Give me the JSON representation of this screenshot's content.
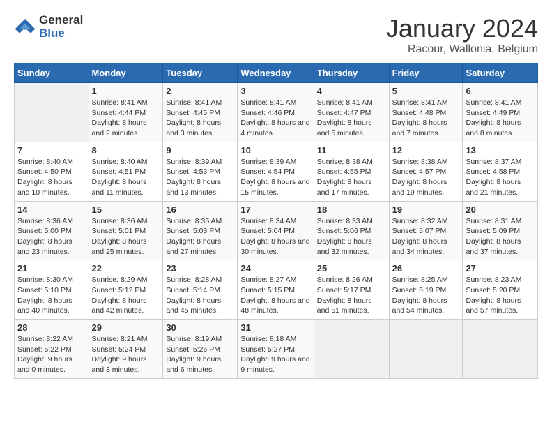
{
  "logo": {
    "general": "General",
    "blue": "Blue"
  },
  "title": "January 2024",
  "subtitle": "Racour, Wallonia, Belgium",
  "days_header": [
    "Sunday",
    "Monday",
    "Tuesday",
    "Wednesday",
    "Thursday",
    "Friday",
    "Saturday"
  ],
  "weeks": [
    [
      {
        "day": "",
        "sunrise": "",
        "sunset": "",
        "daylight": ""
      },
      {
        "day": "1",
        "sunrise": "Sunrise: 8:41 AM",
        "sunset": "Sunset: 4:44 PM",
        "daylight": "Daylight: 8 hours and 2 minutes."
      },
      {
        "day": "2",
        "sunrise": "Sunrise: 8:41 AM",
        "sunset": "Sunset: 4:45 PM",
        "daylight": "Daylight: 8 hours and 3 minutes."
      },
      {
        "day": "3",
        "sunrise": "Sunrise: 8:41 AM",
        "sunset": "Sunset: 4:46 PM",
        "daylight": "Daylight: 8 hours and 4 minutes."
      },
      {
        "day": "4",
        "sunrise": "Sunrise: 8:41 AM",
        "sunset": "Sunset: 4:47 PM",
        "daylight": "Daylight: 8 hours and 5 minutes."
      },
      {
        "day": "5",
        "sunrise": "Sunrise: 8:41 AM",
        "sunset": "Sunset: 4:48 PM",
        "daylight": "Daylight: 8 hours and 7 minutes."
      },
      {
        "day": "6",
        "sunrise": "Sunrise: 8:41 AM",
        "sunset": "Sunset: 4:49 PM",
        "daylight": "Daylight: 8 hours and 8 minutes."
      }
    ],
    [
      {
        "day": "7",
        "sunrise": "Sunrise: 8:40 AM",
        "sunset": "Sunset: 4:50 PM",
        "daylight": "Daylight: 8 hours and 10 minutes."
      },
      {
        "day": "8",
        "sunrise": "Sunrise: 8:40 AM",
        "sunset": "Sunset: 4:51 PM",
        "daylight": "Daylight: 8 hours and 11 minutes."
      },
      {
        "day": "9",
        "sunrise": "Sunrise: 8:39 AM",
        "sunset": "Sunset: 4:53 PM",
        "daylight": "Daylight: 8 hours and 13 minutes."
      },
      {
        "day": "10",
        "sunrise": "Sunrise: 8:39 AM",
        "sunset": "Sunset: 4:54 PM",
        "daylight": "Daylight: 8 hours and 15 minutes."
      },
      {
        "day": "11",
        "sunrise": "Sunrise: 8:38 AM",
        "sunset": "Sunset: 4:55 PM",
        "daylight": "Daylight: 8 hours and 17 minutes."
      },
      {
        "day": "12",
        "sunrise": "Sunrise: 8:38 AM",
        "sunset": "Sunset: 4:57 PM",
        "daylight": "Daylight: 8 hours and 19 minutes."
      },
      {
        "day": "13",
        "sunrise": "Sunrise: 8:37 AM",
        "sunset": "Sunset: 4:58 PM",
        "daylight": "Daylight: 8 hours and 21 minutes."
      }
    ],
    [
      {
        "day": "14",
        "sunrise": "Sunrise: 8:36 AM",
        "sunset": "Sunset: 5:00 PM",
        "daylight": "Daylight: 8 hours and 23 minutes."
      },
      {
        "day": "15",
        "sunrise": "Sunrise: 8:36 AM",
        "sunset": "Sunset: 5:01 PM",
        "daylight": "Daylight: 8 hours and 25 minutes."
      },
      {
        "day": "16",
        "sunrise": "Sunrise: 8:35 AM",
        "sunset": "Sunset: 5:03 PM",
        "daylight": "Daylight: 8 hours and 27 minutes."
      },
      {
        "day": "17",
        "sunrise": "Sunrise: 8:34 AM",
        "sunset": "Sunset: 5:04 PM",
        "daylight": "Daylight: 8 hours and 30 minutes."
      },
      {
        "day": "18",
        "sunrise": "Sunrise: 8:33 AM",
        "sunset": "Sunset: 5:06 PM",
        "daylight": "Daylight: 8 hours and 32 minutes."
      },
      {
        "day": "19",
        "sunrise": "Sunrise: 8:32 AM",
        "sunset": "Sunset: 5:07 PM",
        "daylight": "Daylight: 8 hours and 34 minutes."
      },
      {
        "day": "20",
        "sunrise": "Sunrise: 8:31 AM",
        "sunset": "Sunset: 5:09 PM",
        "daylight": "Daylight: 8 hours and 37 minutes."
      }
    ],
    [
      {
        "day": "21",
        "sunrise": "Sunrise: 8:30 AM",
        "sunset": "Sunset: 5:10 PM",
        "daylight": "Daylight: 8 hours and 40 minutes."
      },
      {
        "day": "22",
        "sunrise": "Sunrise: 8:29 AM",
        "sunset": "Sunset: 5:12 PM",
        "daylight": "Daylight: 8 hours and 42 minutes."
      },
      {
        "day": "23",
        "sunrise": "Sunrise: 8:28 AM",
        "sunset": "Sunset: 5:14 PM",
        "daylight": "Daylight: 8 hours and 45 minutes."
      },
      {
        "day": "24",
        "sunrise": "Sunrise: 8:27 AM",
        "sunset": "Sunset: 5:15 PM",
        "daylight": "Daylight: 8 hours and 48 minutes."
      },
      {
        "day": "25",
        "sunrise": "Sunrise: 8:26 AM",
        "sunset": "Sunset: 5:17 PM",
        "daylight": "Daylight: 8 hours and 51 minutes."
      },
      {
        "day": "26",
        "sunrise": "Sunrise: 8:25 AM",
        "sunset": "Sunset: 5:19 PM",
        "daylight": "Daylight: 8 hours and 54 minutes."
      },
      {
        "day": "27",
        "sunrise": "Sunrise: 8:23 AM",
        "sunset": "Sunset: 5:20 PM",
        "daylight": "Daylight: 8 hours and 57 minutes."
      }
    ],
    [
      {
        "day": "28",
        "sunrise": "Sunrise: 8:22 AM",
        "sunset": "Sunset: 5:22 PM",
        "daylight": "Daylight: 9 hours and 0 minutes."
      },
      {
        "day": "29",
        "sunrise": "Sunrise: 8:21 AM",
        "sunset": "Sunset: 5:24 PM",
        "daylight": "Daylight: 9 hours and 3 minutes."
      },
      {
        "day": "30",
        "sunrise": "Sunrise: 8:19 AM",
        "sunset": "Sunset: 5:26 PM",
        "daylight": "Daylight: 9 hours and 6 minutes."
      },
      {
        "day": "31",
        "sunrise": "Sunrise: 8:18 AM",
        "sunset": "Sunset: 5:27 PM",
        "daylight": "Daylight: 9 hours and 9 minutes."
      },
      {
        "day": "",
        "sunrise": "",
        "sunset": "",
        "daylight": ""
      },
      {
        "day": "",
        "sunrise": "",
        "sunset": "",
        "daylight": ""
      },
      {
        "day": "",
        "sunrise": "",
        "sunset": "",
        "daylight": ""
      }
    ]
  ]
}
